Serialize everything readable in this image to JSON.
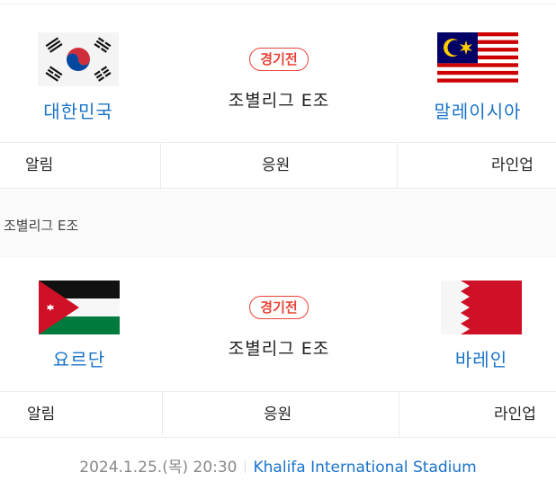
{
  "matches": [
    {
      "home": {
        "name": "대한민국",
        "flag": "south-korea-flag"
      },
      "away": {
        "name": "말레이시아",
        "flag": "malaysia-flag"
      },
      "status": "경기전",
      "group": "조별리그 E조",
      "actions": {
        "alert": "알림",
        "cheer": "응원",
        "lineup": "라인업"
      }
    },
    {
      "home": {
        "name": "요르단",
        "flag": "jordan-flag"
      },
      "away": {
        "name": "바레인",
        "flag": "bahrain-flag"
      },
      "status": "경기전",
      "group": "조별리그 E조",
      "actions": {
        "alert": "알림",
        "cheer": "응원",
        "lineup": "라인업"
      }
    }
  ],
  "section": {
    "title": "조별리그 E조"
  },
  "footer": {
    "datetime": "2024.1.25.(목) 20:30",
    "venue": "Khalifa International Stadium"
  },
  "colors": {
    "link": "#1a73c8",
    "status": "#e8443a",
    "text": "#222222"
  }
}
